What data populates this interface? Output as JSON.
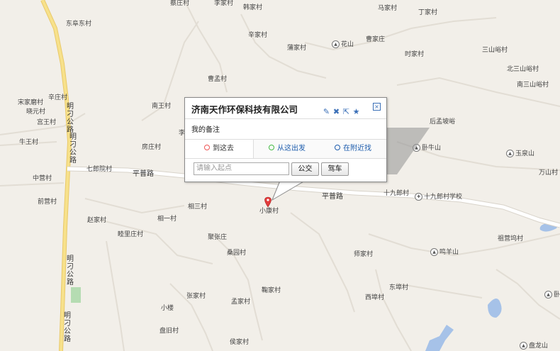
{
  "popup": {
    "title": "济南天作环保科技有限公司",
    "note": "我的备注",
    "tabs": [
      "到这去",
      "从这出发",
      "在附近找"
    ],
    "input_placeholder": "请输入起点",
    "bus_label": "公交",
    "car_label": "驾车",
    "close_label": "×"
  },
  "map": {
    "current_place": "小康村",
    "roads": {
      "pingpu_1": "平普路",
      "pingpu_2": "平普路",
      "mingdao_1": "明刁公路",
      "mingdao_2": "明刁公路",
      "mingdao_3": "明刁公路",
      "mingdao_4": "明刁公路"
    },
    "villages": [
      "蔡庄村",
      "李家村",
      "韩家村",
      "马家村",
      "丁家村",
      "东阜东村",
      "辛家村",
      "蒲家村",
      "花山",
      "曹家庄",
      "时家村",
      "三山峪村",
      "北三山峪村",
      "南三山峪村",
      "曹孟村",
      "辛庄村",
      "宋家磨村",
      "晓元村",
      "宫王村",
      "牛王村",
      "南王村",
      "房庄村",
      "李",
      "后孟坡峪",
      "卧牛山",
      "玉泉山",
      "七郎院村",
      "万山村",
      "中营村",
      "前营村",
      "相三村",
      "十九郎村",
      "十九郎村学校",
      "赵家村",
      "相一村",
      "睦里庄村",
      "聚张庄",
      "桑园村",
      "师家村",
      "鸣羊山",
      "祖营坞村",
      "张家村",
      "孟家村",
      "鞠家村",
      "东埠村",
      "西埠村",
      "小楼",
      "盘旧村",
      "侯家村",
      "卧",
      "盘龙山"
    ]
  },
  "colors": {
    "land": "#f2efe9",
    "road_main": "#ffffff",
    "road_yellow": "#f7e18b",
    "water": "#a6c2e8",
    "green": "#b5dcb2",
    "link": "#1e5dad",
    "pin": "#e23c3c"
  },
  "icons": {
    "edit": "pencil-icon",
    "delete": "x-icon",
    "share": "share-icon",
    "favorite": "star-icon",
    "close": "close-icon",
    "mountain": "mountain-icon",
    "school": "school-icon",
    "marker": "map-pin-icon"
  }
}
